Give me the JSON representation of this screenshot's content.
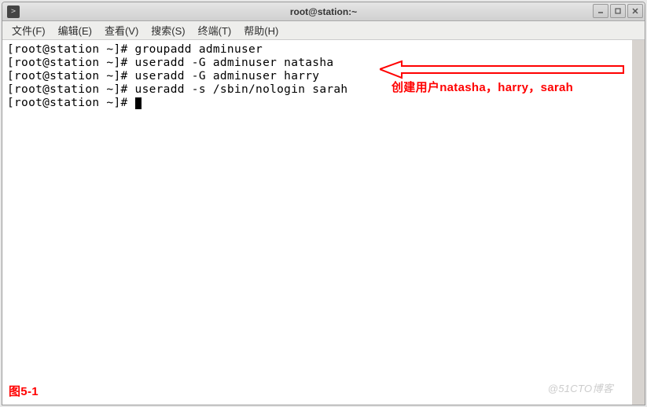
{
  "window": {
    "title": "root@station:~"
  },
  "menu": {
    "file": "文件(F)",
    "edit": "编辑(E)",
    "view": "查看(V)",
    "search": "搜索(S)",
    "terminal": "终端(T)",
    "help": "帮助(H)"
  },
  "terminal": {
    "prompt": "[root@station ~]# ",
    "lines": [
      "groupadd adminuser",
      "useradd -G adminuser natasha",
      "useradd -G adminuser harry",
      "useradd -s /sbin/nologin sarah",
      ""
    ]
  },
  "annotation": {
    "arrow_note": "创建用户natasha，harry，sarah",
    "figure_label": "图5-1"
  },
  "watermark": "@51CTO博客",
  "colors": {
    "annotation": "#ff0000"
  }
}
